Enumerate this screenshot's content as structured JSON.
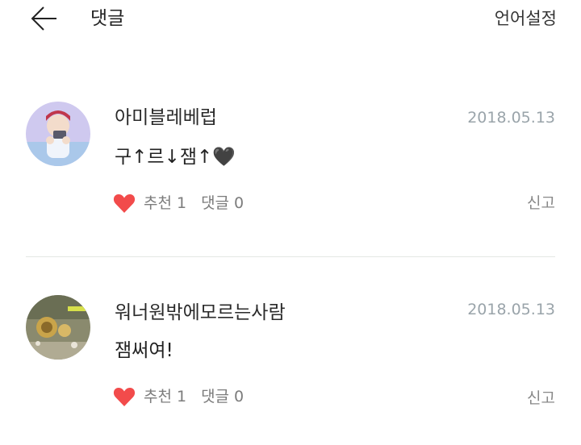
{
  "header": {
    "title": "댓글",
    "language_button": "언어설정"
  },
  "comments": [
    {
      "author": "아미블레베럽",
      "date": "2018.05.13",
      "text": "구↑르↓잼↑🖤",
      "like_label": "추천",
      "like_count": "1",
      "reply_label": "댓글",
      "reply_count": "0",
      "report_label": "신고"
    },
    {
      "author": "워너원밖에모르는사람",
      "date": "2018.05.13",
      "text": "잼써여!",
      "like_label": "추천",
      "like_count": "1",
      "reply_label": "댓글",
      "reply_count": "0",
      "report_label": "신고"
    }
  ],
  "colors": {
    "heart": "#f24b4b",
    "date": "#9aa4aa",
    "divider": "#e3e7e4"
  }
}
